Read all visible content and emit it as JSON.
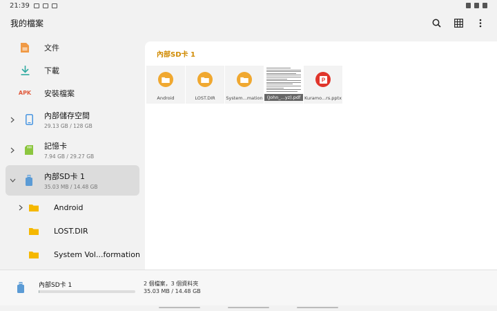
{
  "status": {
    "time": "21:39"
  },
  "header": {
    "title": "我的檔案"
  },
  "sidebar": {
    "categories": [
      {
        "label": "文件",
        "icon": "document-icon",
        "color": "#f09a46"
      },
      {
        "label": "下載",
        "icon": "download-icon",
        "color": "#2eaaa0"
      },
      {
        "label": "安裝檔案",
        "icon": "apk-icon",
        "icon_text": "APK",
        "color": "#e05a3c"
      }
    ],
    "storage": [
      {
        "label": "內部儲存空間",
        "sub": "29.13 GB / 128 GB",
        "icon": "phone-icon",
        "color": "#3a8ee0"
      },
      {
        "label": "記憶卡",
        "sub": "7.94 GB / 29.27 GB",
        "icon": "sd-card-icon",
        "color": "#8cc63f"
      },
      {
        "label": "內部SD卡 1",
        "sub": "35.03 MB / 14.48 GB",
        "icon": "usb-storage-icon",
        "color": "#5b9bd5"
      }
    ],
    "folders": [
      {
        "label": "Android",
        "expandable": true
      },
      {
        "label": "LOST.DIR",
        "expandable": false
      },
      {
        "label": "System Vol...formation",
        "expandable": false
      }
    ]
  },
  "main": {
    "breadcrumb": "內部SD卡 1",
    "files": [
      {
        "name": "Android",
        "type": "folder"
      },
      {
        "name": "LOST.DIR",
        "type": "folder"
      },
      {
        "name": "System...mation",
        "type": "folder"
      },
      {
        "name": "(John_...yz).pdf",
        "type": "pdf"
      },
      {
        "name": "Kuramo...rs.pptx",
        "type": "pptx"
      }
    ]
  },
  "bottom": {
    "name": "內部SD卡 1",
    "counts": "2 個檔案，3 個資料夾",
    "usage": "35.03 MB / 14.48 GB",
    "usage_fraction": 0.002
  }
}
